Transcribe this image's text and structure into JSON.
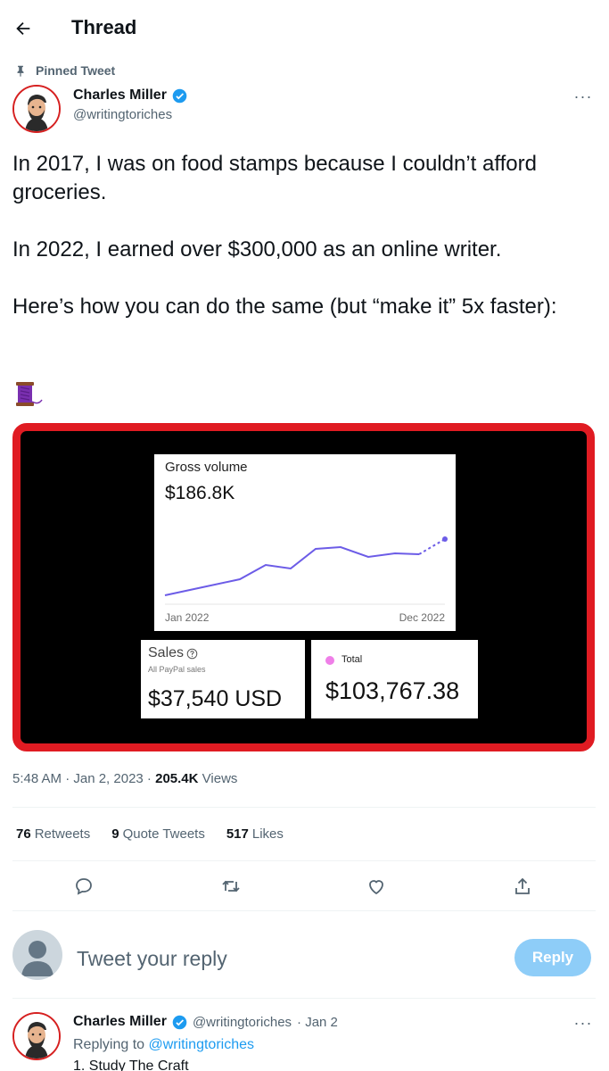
{
  "header": {
    "title": "Thread"
  },
  "pinned": {
    "label": "Pinned Tweet"
  },
  "tweet": {
    "author_name": "Charles Miller",
    "author_handle": "@writingtoriches",
    "paragraphs": [
      "In 2017, I was on food stamps because I couldn’t afford groceries.",
      "In 2022, I earned over $300,000 as an online writer.",
      "Here’s how you can do the same (but “make it” 5x faster):"
    ],
    "emoji_icon": "thread-spool-icon",
    "media": {
      "gross_label": "Gross volume",
      "gross_value": "$186.8K",
      "axis_start": "Jan 2022",
      "axis_end": "Dec 2022",
      "sales_label": "Sales",
      "sales_sub": "All PayPal sales",
      "sales_value": "$37,540 USD",
      "total_label": "Total",
      "total_value": "$103,767.38",
      "line_color": "#6c5ce7",
      "total_dot_color": "#ef7fe8"
    },
    "time": "5:48 AM · Jan 2, 2023",
    "separator": " · ",
    "views_count": "205.4K",
    "views_label": "Views"
  },
  "stats": {
    "retweets_count": "76",
    "retweets_label": "Retweets",
    "quotes_count": "9",
    "quotes_label": "Quote Tweets",
    "likes_count": "517",
    "likes_label": "Likes"
  },
  "reply_box": {
    "placeholder": "Tweet your reply",
    "button": "Reply"
  },
  "reply_tweet": {
    "author_name": "Charles Miller",
    "author_handle": "@writingtoriches",
    "date": "· Jan 2",
    "replying_prefix": "Replying to",
    "replying_handle": "@writingtoriches",
    "snippet": "1. Study The Craft"
  },
  "colors": {
    "accent": "#1d9bf0",
    "media_border": "#e01b22",
    "reply_button": "#8ecdf8"
  }
}
